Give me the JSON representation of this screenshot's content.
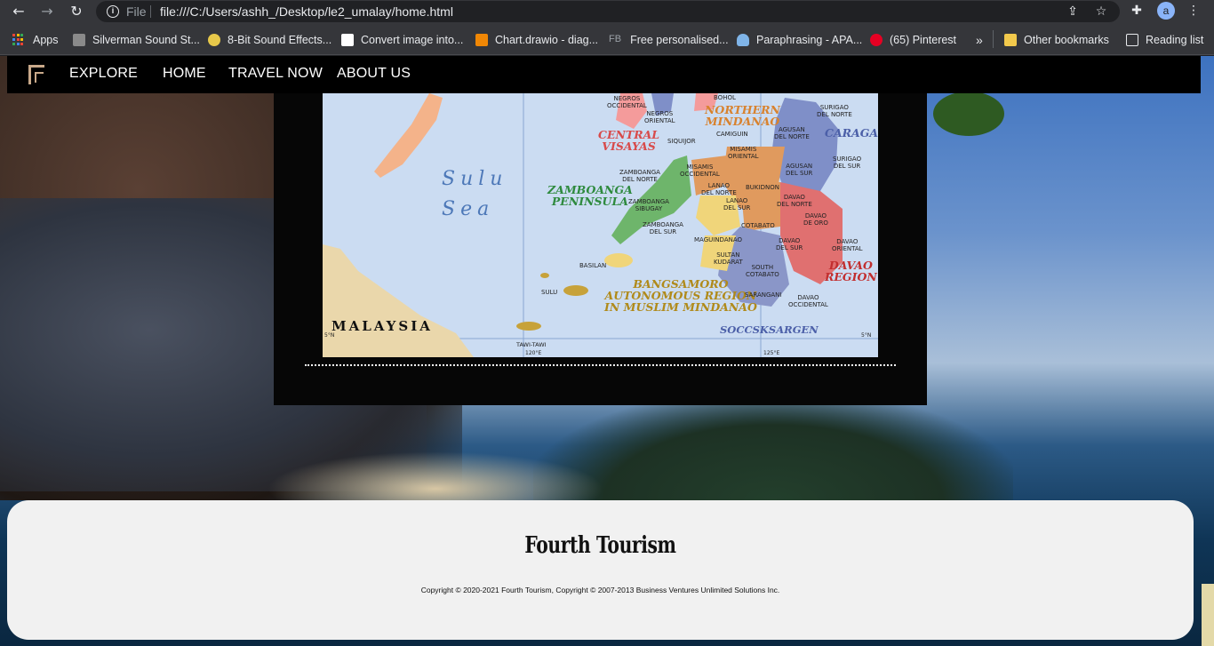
{
  "browser": {
    "scheme_label": "File",
    "url": "file:///C:/Users/ashh_/Desktop/le2_umalay/home.html",
    "profile_initial": "a",
    "icons": [
      "back-arrow-icon",
      "forward-arrow-icon",
      "reload-icon",
      "info-icon",
      "share-icon",
      "star-icon",
      "extensions-icon",
      "kebab-menu-icon"
    ]
  },
  "bookmarks": {
    "apps_label": "Apps",
    "items": [
      {
        "label": "Silverman Sound St...",
        "color": "#8a8a8a"
      },
      {
        "label": "8-Bit Sound Effects...",
        "color": "#e7c84a"
      },
      {
        "label": "Convert image into...",
        "color": "#ffffff"
      },
      {
        "label": "Chart.drawio - diag...",
        "color": "#f08705"
      },
      {
        "label": "Free personalised...",
        "prefix": "FB"
      },
      {
        "label": "Paraphrasing - APA...",
        "color": "#7fb4e8"
      },
      {
        "label": "(65) Pinterest",
        "color": "#e60023"
      }
    ],
    "overflow_label": "»",
    "other_label": "Other bookmarks",
    "reading_label": "Reading list"
  },
  "site_nav": {
    "brand": "EXPLORE",
    "links": [
      "HOME",
      "TRAVEL NOW",
      "ABOUT US"
    ]
  },
  "map": {
    "sea_label": "Sulu\nSea",
    "country_label": "MALAYSIA",
    "regions": [
      {
        "text": "NORTHERN\nMINDANAO",
        "color": "#d8822e"
      },
      {
        "text": "CARAGA",
        "color": "#4b5fa8"
      },
      {
        "text": "CENTRAL\nVISAYAS",
        "color": "#d84a4a"
      },
      {
        "text": "ZAMBOANGA\nPENINSULA",
        "color": "#2e8a3e"
      },
      {
        "text": "DAVAO\nREGION",
        "color": "#c22e2e"
      },
      {
        "text": "BANGSAMORO\nAUTONOMOUS REGION\nIN MUSLIM MINDANAO",
        "color": "#b08a1a"
      },
      {
        "text": "SOCCSKSARGEN",
        "color": "#4b5fa8"
      }
    ],
    "places": [
      "NEGROS\nOCCIDENTAL",
      "NEGROS\nORIENTAL",
      "BOHOL",
      "SIQUIJOR",
      "CAMIGUIN",
      "SURIGAO\nDEL NORTE",
      "AGUSAN\nDEL NORTE",
      "SURIGAO\nDEL SUR",
      "MISAMIS\nORIENTAL",
      "MISAMIS\nOCCIDENTAL",
      "ZAMBOANGA\nDEL NORTE",
      "ZAMBOANGA\nSIBUGAY",
      "LANAO\nDEL NORTE",
      "BUKIDNON",
      "AGUSAN\nDEL SUR",
      "LANAO\nDEL SUR",
      "DAVAO\nDEL NORTE",
      "DAVAO\nDE ORO",
      "ZAMBOANGA\nDEL SUR",
      "COTABATO",
      "MAGUINDANAO",
      "DAVAO\nDEL SUR",
      "DAVAO\nORIENTAL",
      "BASILAN",
      "SULTAN\nKUDARAT",
      "SOUTH\nCOTABATO",
      "SULU",
      "SARANGANI",
      "DAVAO\nOCCIDENTAL",
      "TAWI-TAWI"
    ],
    "grid_labels": [
      "5°N",
      "5°N",
      "120°E",
      "125°E"
    ]
  },
  "footer": {
    "brand": "Fourth Tourism",
    "copyright": "Copyright © 2020-2021 Fourth Tourism, Copyright © 2007-2013 Business Ventures Unlimited Solutions Inc."
  }
}
